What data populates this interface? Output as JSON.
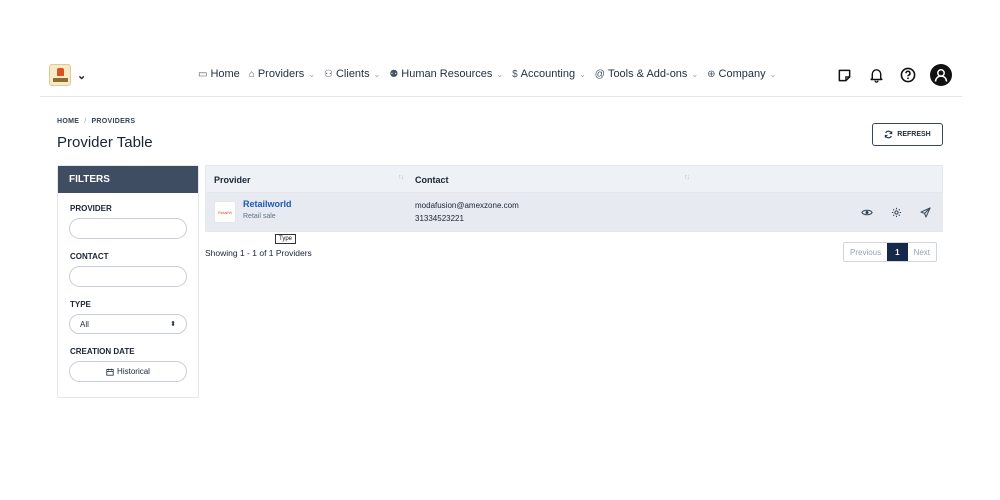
{
  "nav": {
    "items": [
      {
        "label": "Home",
        "icon": "monitor-icon",
        "glyph": "▭",
        "dropdown": false
      },
      {
        "label": "Providers",
        "icon": "building-icon",
        "glyph": "⌂",
        "dropdown": true
      },
      {
        "label": "Clients",
        "icon": "users-icon",
        "glyph": "⚇",
        "dropdown": true
      },
      {
        "label": "Human Resources",
        "icon": "user-group-icon",
        "glyph": "⚉",
        "dropdown": true
      },
      {
        "label": "Accounting",
        "icon": "dollar-icon",
        "glyph": "$",
        "dropdown": true
      },
      {
        "label": "Tools & Add-ons",
        "icon": "at-icon",
        "glyph": "@",
        "dropdown": true
      },
      {
        "label": "Company",
        "icon": "globe-icon",
        "glyph": "⊕",
        "dropdown": true
      }
    ]
  },
  "breadcrumb": {
    "home": "HOME",
    "separator": "/",
    "current": "PROVIDERS"
  },
  "page_title": "Provider Table",
  "refresh_label": "REFRESH",
  "filters": {
    "title": "FILTERS",
    "provider_label": "PROVIDER",
    "contact_label": "CONTACT",
    "type_label": "TYPE",
    "type_value": "All",
    "creation_date_label": "CREATION DATE",
    "creation_date_value": "Historical"
  },
  "table": {
    "col_provider": "Provider",
    "col_contact": "Contact",
    "rows": [
      {
        "name": "Retailworld",
        "type": "Retail sale",
        "logo_text": "RetailW",
        "email": "modafusion@amexzone.com",
        "phone": "31334523221"
      }
    ]
  },
  "tooltip": "Type",
  "showing": "Showing 1 - 1 of 1 Providers",
  "pagination": {
    "previous": "Previous",
    "current": "1",
    "next": "Next"
  },
  "colors": {
    "accent": "#16294d",
    "filters_header": "#3f4d63",
    "link": "#1d58b8"
  }
}
